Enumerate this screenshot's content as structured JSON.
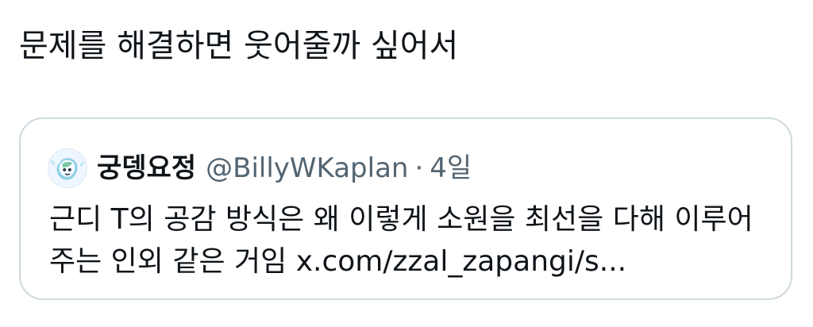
{
  "tweet": {
    "text": "문제를 해결하면 웃어줄까 싶어서"
  },
  "quote": {
    "display_name": "궁뎅요정",
    "handle": "@BillyWKaplan",
    "separator": "·",
    "time": "4일",
    "avatar_icon": "profile-avatar-icon",
    "body_line_1": "근디 T의 공감 방식은 왜 이렇게 소원을 최선을 다해 이루어",
    "body_line_2": "주는 인외 같은 거임 x.com/zzal_zapangi/s..."
  }
}
